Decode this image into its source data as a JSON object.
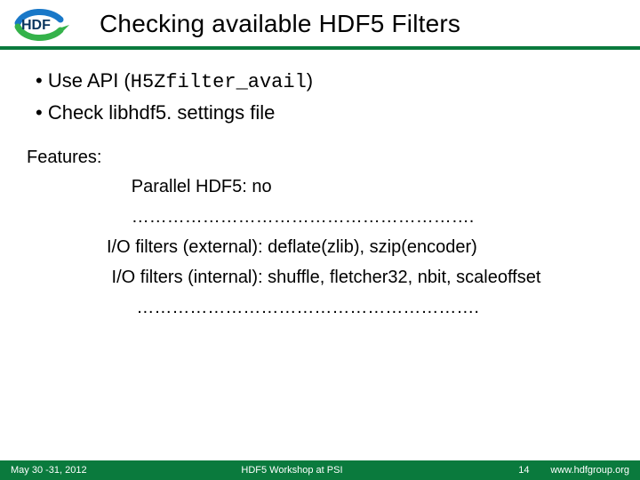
{
  "header": {
    "title": "Checking available HDF5 Filters"
  },
  "bullets": {
    "b1_prefix": "Use API (",
    "b1_code": "H5Zfilter_avail",
    "b1_suffix": ")",
    "b2": "Check libhdf5. settings file"
  },
  "features": {
    "label": "Features:",
    "line1": "     Parallel HDF5: no",
    "dots1": "     ………………………………………………….",
    "line2": "I/O filters (external): deflate(zlib), szip(encoder)",
    "line3": " I/O filters (internal): shuffle, fletcher32, nbit, scaleoffset",
    "dots2": "      …………………………………………………."
  },
  "footer": {
    "date": "May 30 -31, 2012",
    "center": "HDF5 Workshop at PSI",
    "page": "14",
    "url": "www.hdfgroup.org"
  },
  "colors": {
    "accent": "#0a7a3d"
  }
}
